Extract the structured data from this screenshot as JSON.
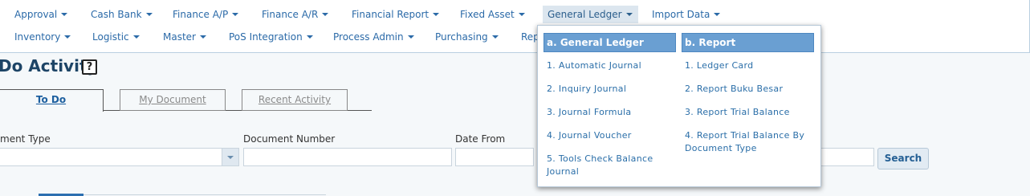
{
  "menu": {
    "row1": [
      "Approval",
      "Cash Bank",
      "Finance A/P",
      "Finance A/R",
      "Financial Report",
      "Fixed Asset",
      "General Ledger",
      "Import Data"
    ],
    "row2": [
      "Inventory",
      "Logistic",
      "Master",
      "PoS Integration",
      "Process Admin",
      "Purchasing",
      "Rep"
    ]
  },
  "page": {
    "title": "Do Activity",
    "help": "?"
  },
  "tabs": [
    "To Do",
    "My Document",
    "Recent Activity"
  ],
  "filters": {
    "document_type_label": "ment Type",
    "document_number_label": "Document Number",
    "date_from_label": "Date From",
    "search_button": "Search"
  },
  "general_ledger_menu": {
    "col_a": {
      "header": "a. General Ledger",
      "items": [
        "1. Automatic Journal",
        "2. Inquiry Journal",
        "3. Journal Formula",
        "4. Journal Voucher",
        "5. Tools Check Balance Journal"
      ]
    },
    "col_b": {
      "header": "b. Report",
      "items": [
        "1. Ledger Card",
        "2. Report Buku Besar",
        "3. Report Trial Balance",
        "4. Report Trial Balance By Document Type"
      ]
    }
  },
  "colors": {
    "menu_text": "#2b6aa8",
    "header_blue": "#6a9fd2",
    "page_title": "#1d4466"
  }
}
